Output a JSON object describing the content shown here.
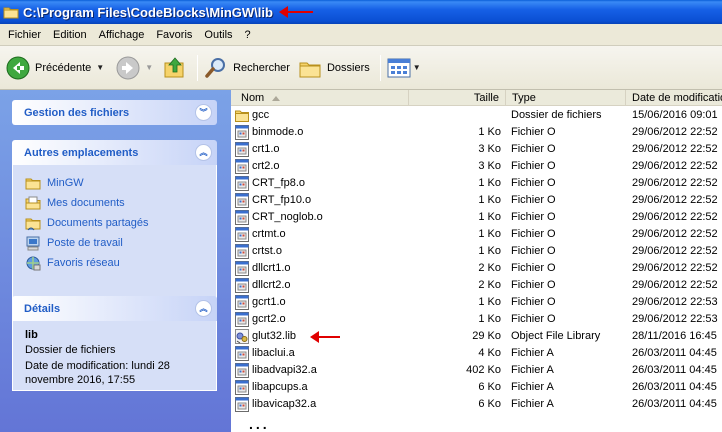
{
  "window": {
    "title": "C:\\Program Files\\CodeBlocks\\MinGW\\lib",
    "title_arrow": "red-left-arrow"
  },
  "menu": [
    "Fichier",
    "Edition",
    "Affichage",
    "Favoris",
    "Outils",
    "?"
  ],
  "toolbar": {
    "back_label": "Précédente",
    "search_label": "Rechercher",
    "folders_label": "Dossiers"
  },
  "sidebar": {
    "file_tasks": {
      "title": "Gestion des fichiers"
    },
    "other_places": {
      "title": "Autres emplacements",
      "items": [
        {
          "label": "MinGW",
          "icon": "folder-icon"
        },
        {
          "label": "Mes documents",
          "icon": "my-documents-icon"
        },
        {
          "label": "Documents partagés",
          "icon": "shared-folder-icon"
        },
        {
          "label": "Poste de travail",
          "icon": "my-computer-icon"
        },
        {
          "label": "Favoris réseau",
          "icon": "network-icon"
        }
      ]
    },
    "details": {
      "title": "Détails",
      "name": "lib",
      "type": "Dossier de fichiers",
      "modified_line1": "Date de modification: lundi 28",
      "modified_line2": "novembre 2016, 17:55"
    }
  },
  "columns": {
    "name": "Nom",
    "size": "Taille",
    "type": "Type",
    "date": "Date de modificatio"
  },
  "files": [
    {
      "name": "gcc",
      "size": "",
      "type": "Dossier de fichiers",
      "date": "15/06/2016 09:01",
      "icon": "folder"
    },
    {
      "name": "binmode.o",
      "size": "1 Ko",
      "type": "Fichier O",
      "date": "29/06/2012 22:52",
      "icon": "file"
    },
    {
      "name": "crt1.o",
      "size": "3 Ko",
      "type": "Fichier O",
      "date": "29/06/2012 22:52",
      "icon": "file"
    },
    {
      "name": "crt2.o",
      "size": "3 Ko",
      "type": "Fichier O",
      "date": "29/06/2012 22:52",
      "icon": "file"
    },
    {
      "name": "CRT_fp8.o",
      "size": "1 Ko",
      "type": "Fichier O",
      "date": "29/06/2012 22:52",
      "icon": "file"
    },
    {
      "name": "CRT_fp10.o",
      "size": "1 Ko",
      "type": "Fichier O",
      "date": "29/06/2012 22:52",
      "icon": "file"
    },
    {
      "name": "CRT_noglob.o",
      "size": "1 Ko",
      "type": "Fichier O",
      "date": "29/06/2012 22:52",
      "icon": "file"
    },
    {
      "name": "crtmt.o",
      "size": "1 Ko",
      "type": "Fichier O",
      "date": "29/06/2012 22:52",
      "icon": "file"
    },
    {
      "name": "crtst.o",
      "size": "1 Ko",
      "type": "Fichier O",
      "date": "29/06/2012 22:52",
      "icon": "file"
    },
    {
      "name": "dllcrt1.o",
      "size": "2 Ko",
      "type": "Fichier O",
      "date": "29/06/2012 22:52",
      "icon": "file"
    },
    {
      "name": "dllcrt2.o",
      "size": "2 Ko",
      "type": "Fichier O",
      "date": "29/06/2012 22:52",
      "icon": "file"
    },
    {
      "name": "gcrt1.o",
      "size": "1 Ko",
      "type": "Fichier O",
      "date": "29/06/2012 22:53",
      "icon": "file"
    },
    {
      "name": "gcrt2.o",
      "size": "1 Ko",
      "type": "Fichier O",
      "date": "29/06/2012 22:53",
      "icon": "file"
    },
    {
      "name": "glut32.lib",
      "size": "29 Ko",
      "type": "Object File Library",
      "date": "28/11/2016 16:45",
      "icon": "library",
      "marked": true
    },
    {
      "name": "libaclui.a",
      "size": "4 Ko",
      "type": "Fichier A",
      "date": "26/03/2011 04:45",
      "icon": "file"
    },
    {
      "name": "libadvapi32.a",
      "size": "402 Ko",
      "type": "Fichier A",
      "date": "26/03/2011 04:45",
      "icon": "file"
    },
    {
      "name": "libapcups.a",
      "size": "6 Ko",
      "type": "Fichier A",
      "date": "26/03/2011 04:45",
      "icon": "file"
    },
    {
      "name": "libavicap32.a",
      "size": "6 Ko",
      "type": "Fichier A",
      "date": "26/03/2011 04:45",
      "icon": "file"
    }
  ],
  "list_more": "...",
  "colors": {
    "annotation_arrow": "#e00000",
    "link": "#215dc6",
    "title_bar": "#0a4fd3"
  }
}
